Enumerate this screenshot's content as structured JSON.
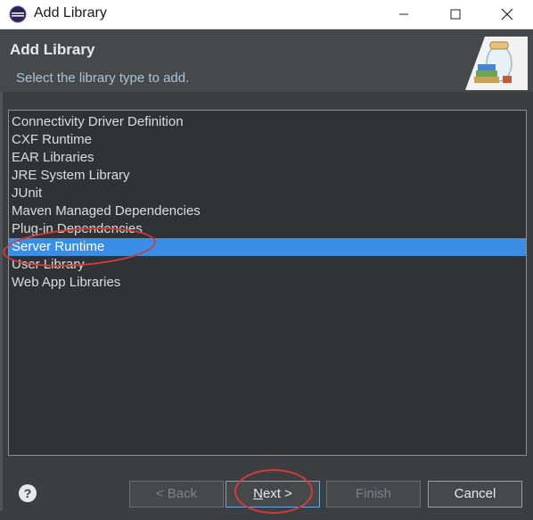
{
  "window": {
    "title": "Add Library",
    "icon": "eclipse-icon",
    "controls": [
      "minimize-icon",
      "maximize-icon",
      "close-icon"
    ]
  },
  "header": {
    "title": "Add Library",
    "description": "Select the library type to add.",
    "icon": "library-books-icon"
  },
  "library_types": [
    {
      "label": "Connectivity Driver Definition",
      "selected": false
    },
    {
      "label": "CXF Runtime",
      "selected": false
    },
    {
      "label": "EAR Libraries",
      "selected": false
    },
    {
      "label": "JRE System Library",
      "selected": false
    },
    {
      "label": "JUnit",
      "selected": false
    },
    {
      "label": "Maven Managed Dependencies",
      "selected": false
    },
    {
      "label": "Plug-in Dependencies",
      "selected": false
    },
    {
      "label": "Server Runtime",
      "selected": true
    },
    {
      "label": "User Library",
      "selected": false
    },
    {
      "label": "Web App Libraries",
      "selected": false
    }
  ],
  "footer": {
    "help": "?",
    "back": "< Back",
    "next_mnemonic": "N",
    "next_rest": "ext >",
    "finish": "Finish",
    "cancel": "Cancel"
  },
  "colors": {
    "selection": "#3a8ee6",
    "annotation": "#d23b3b"
  }
}
